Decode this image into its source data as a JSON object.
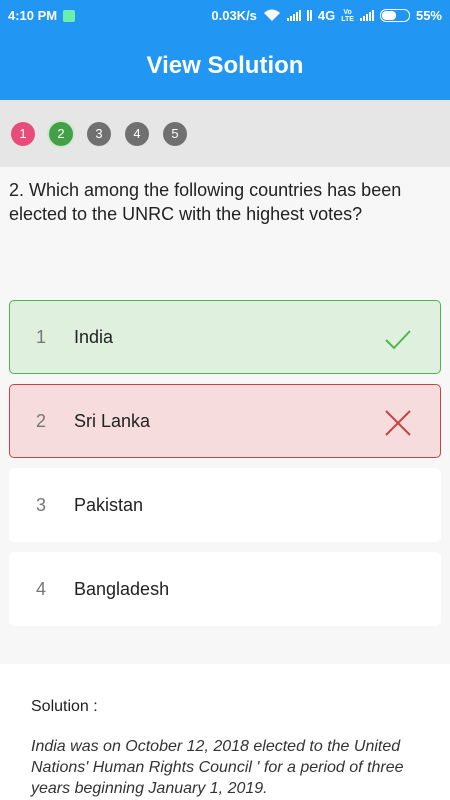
{
  "status_bar": {
    "time": "4:10 PM",
    "speed": "0.03K/s",
    "network": "4G",
    "battery": "55%"
  },
  "header": {
    "title": "View Solution"
  },
  "question_nav": [
    {
      "number": "1",
      "state": "wrong"
    },
    {
      "number": "2",
      "state": "current"
    },
    {
      "number": "3",
      "state": "unvisited"
    },
    {
      "number": "4",
      "state": "unvisited"
    },
    {
      "number": "5",
      "state": "unvisited"
    }
  ],
  "question": {
    "text": "2. Which among the following countries has been elected to the UNRC with the highest votes?"
  },
  "options": [
    {
      "number": "1",
      "label": "India",
      "state": "correct"
    },
    {
      "number": "2",
      "label": "Sri Lanka",
      "state": "incorrect"
    },
    {
      "number": "3",
      "label": "Pakistan",
      "state": "neutral"
    },
    {
      "number": "4",
      "label": "Bangladesh",
      "state": "neutral"
    }
  ],
  "solution": {
    "title": "Solution :",
    "text": "India was on October 12, 2018 elected to the United Nations' Human Rights Council ' for a period of three years beginning January 1, 2019."
  },
  "colors": {
    "primary": "#2196f3",
    "correct": "#48b948",
    "incorrect": "#c74444"
  }
}
